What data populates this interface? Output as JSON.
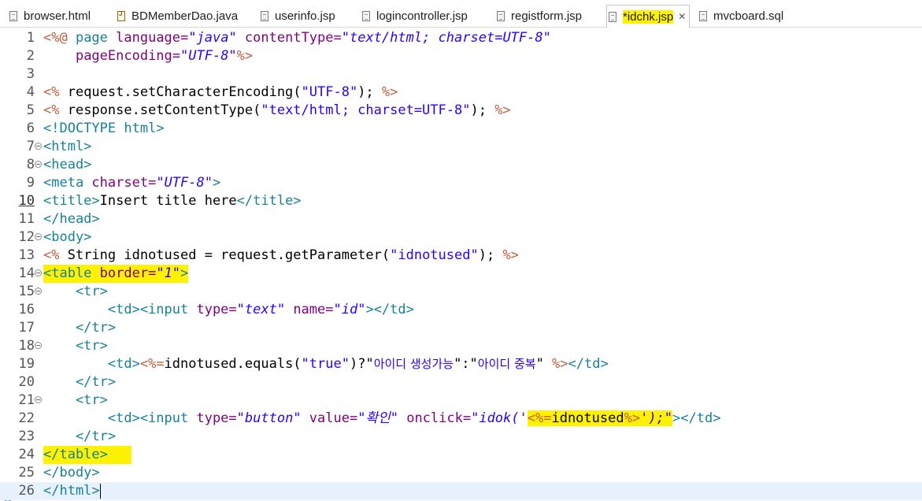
{
  "tabs": [
    {
      "label": "browser.html",
      "icon": "html-file-icon",
      "active": false
    },
    {
      "label": "BDMemberDao.java",
      "icon": "java-file-icon",
      "active": false
    },
    {
      "label": "userinfo.jsp",
      "icon": "jsp-file-icon",
      "active": false
    },
    {
      "label": "logincontroller.jsp",
      "icon": "jsp-file-icon",
      "active": false
    },
    {
      "label": "registform.jsp",
      "icon": "jsp-file-icon",
      "active": false
    },
    {
      "label": "*idchk.jsp",
      "icon": "jsp-file-icon",
      "active": true,
      "close": "✕"
    },
    {
      "label": "mvcboard.sql",
      "icon": "sql-file-icon",
      "active": false
    }
  ],
  "highlight_color": "#fff200",
  "editor": {
    "line_numbers": [
      "1",
      "2",
      "3",
      "4",
      "5",
      "6",
      "7",
      "8",
      "9",
      "10",
      "11",
      "12",
      "13",
      "14",
      "15",
      "16",
      "17",
      "18",
      "19",
      "20",
      "21",
      "22",
      "23",
      "24",
      "25",
      "26"
    ],
    "lines": {
      "l1": {
        "a": "<%@ ",
        "b": "page ",
        "c": "language=",
        "d": "\"java\" ",
        "e": "contentType=",
        "f": "\"text/html; charset=UTF-8\""
      },
      "l2": {
        "a": "    ",
        "b": "pageEncoding=",
        "c": "\"UTF-8\"",
        "d": "%>"
      },
      "l4": {
        "a": "<% ",
        "b": "request.setCharacterEncoding(",
        "c": "\"UTF-8\"",
        "d": "); ",
        "e": "%>"
      },
      "l5": {
        "a": "<% ",
        "b": "response.setContentType(",
        "c": "\"text/html; charset=UTF-8\"",
        "d": "); ",
        "e": "%>"
      },
      "l6": {
        "a": "<!DOCTYPE ",
        "b": "html",
        "c": ">"
      },
      "l7": {
        "a": "<html>"
      },
      "l8": {
        "a": "<head>"
      },
      "l9": {
        "a": "<meta ",
        "b": "charset=",
        "c": "\"UTF-8\"",
        "d": ">"
      },
      "l10": {
        "a": "<title>",
        "b": "Insert title here",
        "c": "</title>"
      },
      "l11": {
        "a": "</head>"
      },
      "l12": {
        "a": "<body>"
      },
      "l13": {
        "a": "<% ",
        "b": "String idnotused = request.getParameter(",
        "c": "\"idnotused\"",
        "d": "); ",
        "e": "%>"
      },
      "l14": {
        "a": "<table ",
        "b": "border=",
        "c": "\"1\"",
        "d": ">"
      },
      "l15": {
        "a": "    <tr>"
      },
      "l16": {
        "a": "        <td><input ",
        "b": "type=",
        "c": "\"text\" ",
        "d": "name=",
        "e": "\"id\"",
        "f": "></td>"
      },
      "l17": {
        "a": "    </tr>"
      },
      "l18": {
        "a": "    <tr>"
      },
      "l19": {
        "a": "        <td>",
        "b": "<%=",
        "c": "idnotused.equals(",
        "d": "\"true\"",
        "e": ")?\"",
        "f": "아이디 생성가능",
        "g": "\":\"",
        "h": "아이디 중복",
        "i": "\" ",
        "j": "%>",
        "k": "</td>"
      },
      "l20": {
        "a": "    </tr>"
      },
      "l21": {
        "a": "    <tr>"
      },
      "l22": {
        "a": "        <td><input ",
        "b": "type=",
        "c": "\"button\" ",
        "d": "value=",
        "e": "\"확인\" ",
        "f": "onclick=",
        "g": "\"idok('",
        "h": "<%=",
        "i": "idnotused",
        "j": "%>",
        "k": "');\"",
        "l": "></td>"
      },
      "l23": {
        "a": "    </tr>"
      },
      "l24": {
        "a": "</table>"
      },
      "l25": {
        "a": "</body>"
      },
      "l26": {
        "a": "</html>"
      }
    }
  }
}
